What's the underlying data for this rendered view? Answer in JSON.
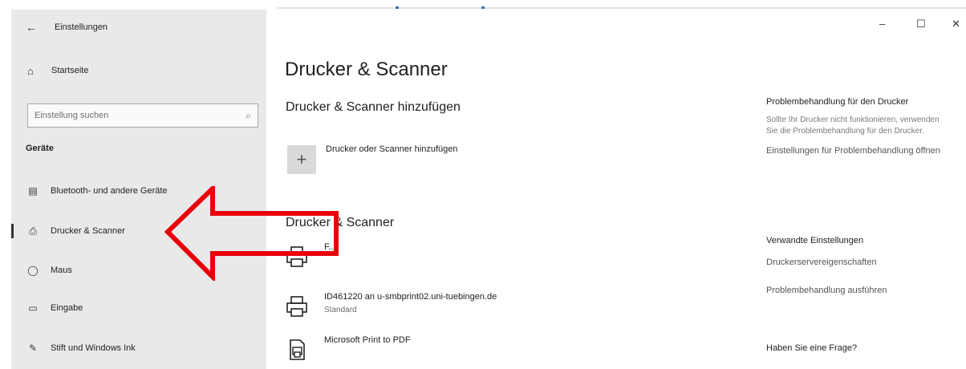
{
  "window": {
    "title": "Einstellungen",
    "back_glyph": "←",
    "minimize_glyph": "–",
    "maximize_glyph": "☐",
    "close_glyph": "✕"
  },
  "sidebar": {
    "home": {
      "label": "Startseite",
      "icon": "home-icon",
      "glyph": "⌂"
    },
    "search": {
      "placeholder": "Einstellung suchen",
      "value": "",
      "icon": "search-icon",
      "glyph": "⌕"
    },
    "section_title": "Geräte",
    "items": [
      {
        "label": "Bluetooth- und andere Geräte",
        "icon": "bluetooth-devices-icon",
        "glyph": "▤",
        "active": false
      },
      {
        "label": "Drucker & Scanner",
        "icon": "printer-icon",
        "glyph": "⎙",
        "active": true
      },
      {
        "label": "Maus",
        "icon": "mouse-icon",
        "glyph": "◯",
        "active": false
      },
      {
        "label": "Eingabe",
        "icon": "keyboard-icon",
        "glyph": "▭",
        "active": false
      },
      {
        "label": "Stift und Windows Ink",
        "icon": "pen-icon",
        "glyph": "✎",
        "active": false
      }
    ]
  },
  "main": {
    "page_title": "Drucker & Scanner",
    "add_section_title": "Drucker & Scanner hinzufügen",
    "add_button": {
      "label": "Drucker oder Scanner hinzufügen",
      "glyph": "+"
    },
    "list_section_title": "Drucker & Scanner",
    "printers": [
      {
        "name": "F...",
        "status": "",
        "icon": "printer-icon"
      },
      {
        "name": "ID461220 an u-smbprint02.uni-tuebingen.de",
        "status": "Standard",
        "icon": "printer-icon"
      },
      {
        "name": "Microsoft Print to PDF",
        "status": "",
        "icon": "pdf-printer-icon"
      }
    ]
  },
  "right": {
    "troubleshoot_title": "Problembehandlung für den Drucker",
    "troubleshoot_text": "Sollte Ihr Drucker nicht funktionieren, verwenden Sie die Problembehandlung für den Drucker.",
    "troubleshoot_link": "Einstellungen für Problembehandlung öffnen",
    "related_title": "Verwandte Einstellungen",
    "related_links": [
      "Druckerservereigenschaften",
      "Problembehandlung ausführen"
    ],
    "question_title": "Haben Sie eine Frage?"
  },
  "colors": {
    "sidebar_bg": "#e9e9e9",
    "arrow": "#e8000b",
    "tile": "#d9d9d9"
  }
}
